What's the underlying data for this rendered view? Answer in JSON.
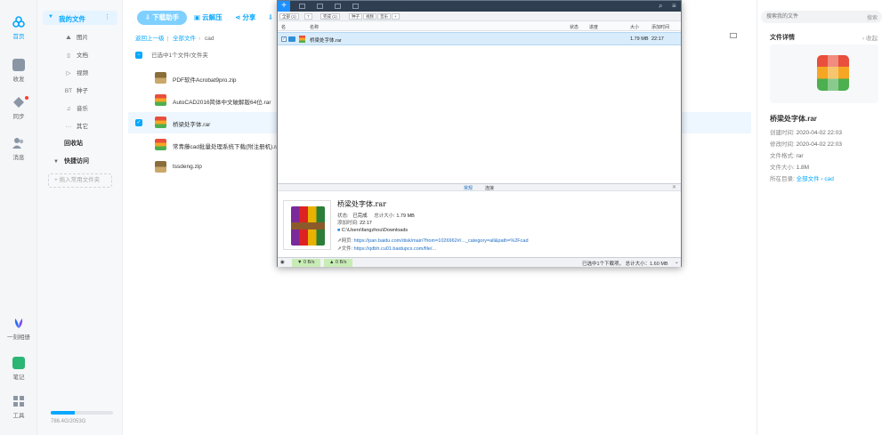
{
  "rail": {
    "items": [
      {
        "label": "首页",
        "icon": "cloud-logo-icon"
      },
      {
        "label": "收发",
        "icon": "inbox-icon"
      },
      {
        "label": "同步",
        "icon": "sync-icon"
      },
      {
        "label": "消息",
        "icon": "people-icon"
      },
      {
        "label": "一刻相册",
        "icon": "album-icon"
      },
      {
        "label": "笔记",
        "icon": "note-icon"
      },
      {
        "label": "工具",
        "icon": "tools-icon"
      }
    ]
  },
  "sidebar": {
    "my_files": "我的文件",
    "more": "⋮",
    "categories": [
      {
        "label": "图片",
        "glyph": "⛰"
      },
      {
        "label": "文档",
        "glyph": "▯"
      },
      {
        "label": "视频",
        "glyph": "▷"
      },
      {
        "label": "种子",
        "glyph": "BT"
      },
      {
        "label": "音乐",
        "glyph": "♫"
      },
      {
        "label": "其它",
        "glyph": "···"
      }
    ],
    "recycle_bin": "回收站",
    "quick_access": "快捷访问",
    "add_folder": "+ 拖入常用文件夹",
    "quota": {
      "text": "786.4G/2053G",
      "fraction": 0.383
    }
  },
  "toolbar": {
    "download_helper": "下载助手",
    "cloud_unzip": "云解压",
    "share": "分享"
  },
  "breadcrumb": {
    "back": "返回上一级",
    "all": "全部文件",
    "current": "cad"
  },
  "selection_text": "已选中1个文件/文件夹",
  "files": [
    {
      "name": "PDF软件Acrobat9pro.zip",
      "type": "zip",
      "selected": false
    },
    {
      "name": "AutoCAD2016简体中文破解版64位.rar",
      "type": "rar",
      "selected": false
    },
    {
      "name": "桥梁处字体.rar",
      "type": "rar",
      "selected": true
    },
    {
      "name": "常青藤cad批量处理系统下载(附注册机).rar",
      "type": "rar",
      "selected": false
    },
    {
      "name": "tssdeng.zip",
      "type": "zip",
      "selected": false
    }
  ],
  "details": {
    "search_placeholder": "搜索我的文件",
    "search_btn": "搜索",
    "title": "文件详情",
    "collapse": "› 收起",
    "name": "桥梁处字体.rar",
    "rows": [
      {
        "label": "创建时间:",
        "value": "2020-04-02 22:03"
      },
      {
        "label": "修改时间:",
        "value": "2020-04-02 22:03"
      },
      {
        "label": "文件格式:",
        "value": "rar"
      },
      {
        "label": "文件大小:",
        "value": "1.8M"
      }
    ],
    "location_label": "所在目录:",
    "location_value": "全部文件 › cad"
  },
  "download_manager": {
    "filters": [
      "全部 (1)",
      "?",
      "完成 (1)",
      "种子",
      "视频",
      "音乐",
      "+"
    ],
    "columns": [
      "名",
      "名称",
      "状态",
      "进度",
      "大小",
      "添加时间"
    ],
    "row": {
      "name": "桥梁处字体.rar",
      "size": "1.79 MB",
      "time": "22:17"
    },
    "tabs": [
      "常规",
      "连接"
    ],
    "detail": {
      "name": "桥梁处字体.rar",
      "status_label": "状态:",
      "status_value": "已完成",
      "total_label": "总计大小:",
      "total_value": "1.79 MB",
      "added_label": "添加时间:",
      "added_value": "22:17",
      "path": "C:\\Users\\fangzhou\\Downloads",
      "page_label": "网页:",
      "page_url": "https://pan.baidu.com/disk/main?from=1026962#/..._category=all&path=%2Fcad",
      "file_label": "文件:",
      "file_url": "https://qdbh.cu01.baidupcs.com/file/..."
    },
    "status": {
      "down": "▼ 0 B/s",
      "up": "▲ 0 B/s",
      "summary": "已选中1个下载项，  总计大小：1.60 MB"
    }
  }
}
